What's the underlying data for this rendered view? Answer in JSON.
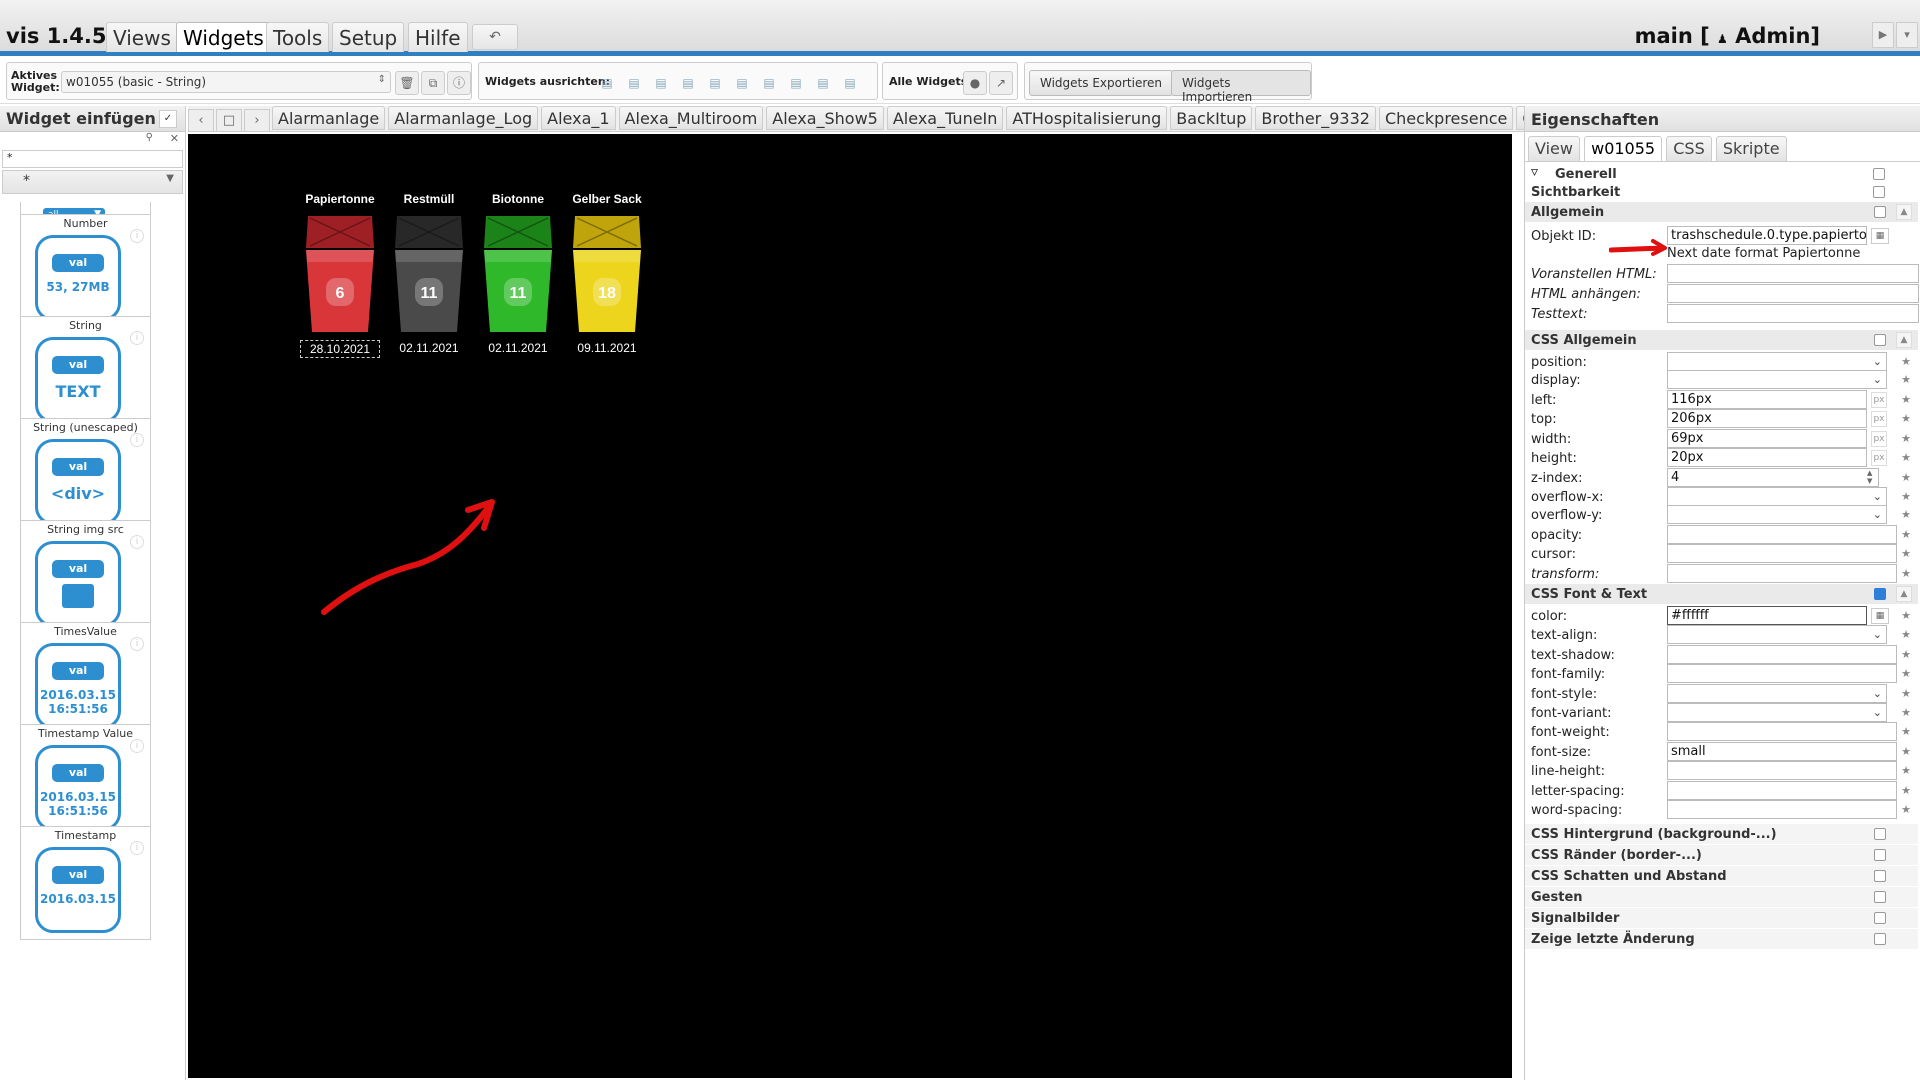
{
  "app": {
    "title": "vis 1.4.5",
    "project_label": "main [",
    "user_icon": "user-icon",
    "user": "Admin]"
  },
  "menu": {
    "tabs": [
      "Views",
      "Widgets",
      "Tools",
      "Setup",
      "Hilfe"
    ],
    "active": "Widgets",
    "undo": "↶"
  },
  "toolbar": {
    "active_widget_label": "Aktives Widget:",
    "active_widget_value": "w01055 (basic - String)",
    "align_label": "Widgets ausrichten:",
    "all_widgets_label": "Alle Widgets:",
    "export_label": "Widgets Exportieren",
    "import_label": "Widgets Importieren"
  },
  "left_panel": {
    "title": "Widget einfügen",
    "filter_value": "*",
    "set_value": "*",
    "top_select": "all",
    "cards": [
      {
        "title": "Number",
        "text": "53, 27MB"
      },
      {
        "title": "String",
        "text": "TEXT"
      },
      {
        "title": "String (unescaped)",
        "text": "<div>"
      },
      {
        "title": "String img src",
        "text": ""
      },
      {
        "title": "TimesValue",
        "text": "2016.03.15 16:51:56"
      },
      {
        "title": "Timestamp Value",
        "text": "2016.03.15 16:51:56"
      },
      {
        "title": "Timestamp",
        "text": "2016.03.15"
      }
    ],
    "val_badge": "val"
  },
  "view_tabs": [
    "Alarmanlage",
    "Alarmanlage_Log",
    "Alexa_1",
    "Alexa_Multiroom",
    "Alexa_Show5",
    "Alexa_TuneIn",
    "ATHospitalisierung",
    "BackItup",
    "Brother_9332",
    "Checkpresence",
    "Corona_At"
  ],
  "canvas": {
    "bins": [
      {
        "label": "Papiertonne",
        "days": "6",
        "date": "28.10.2021",
        "color": "#d9363a",
        "dark": "#a82226",
        "selected": true
      },
      {
        "label": "Restmüll",
        "days": "11",
        "date": "02.11.2021",
        "color": "#4a4a4a",
        "dark": "#2a2a2a",
        "selected": false
      },
      {
        "label": "Biotonne",
        "days": "11",
        "date": "02.11.2021",
        "color": "#2fb92a",
        "dark": "#1e8a1a",
        "selected": false
      },
      {
        "label": "Gelber Sack",
        "days": "18",
        "date": "09.11.2021",
        "color": "#ecd51c",
        "dark": "#c9ae0c",
        "selected": false
      }
    ]
  },
  "right_panel": {
    "title": "Eigenschaften",
    "tabs": [
      "View",
      "w01055",
      "CSS",
      "Skripte"
    ],
    "active_tab": "w01055",
    "generell": "Generell",
    "sichtbarkeit": "Sichtbarkeit",
    "allgemein": "Allgemein",
    "objekt_id_label": "Objekt ID:",
    "objekt_id_value": "trashschedule.0.type.papierto",
    "objekt_id_hint": "Next date format Papiertonne",
    "voranstellen": "Voranstellen HTML:",
    "anhaengen": "HTML anhängen:",
    "testtext": "Testtext:",
    "css_allgemein": "CSS Allgemein",
    "css_rows": [
      {
        "label": "position:",
        "value": ""
      },
      {
        "label": "display:",
        "value": ""
      },
      {
        "label": "left:",
        "value": "116px"
      },
      {
        "label": "top:",
        "value": "206px"
      },
      {
        "label": "width:",
        "value": "69px"
      },
      {
        "label": "height:",
        "value": "20px"
      },
      {
        "label": "z-index:",
        "value": "4"
      },
      {
        "label": "overflow-x:",
        "value": ""
      },
      {
        "label": "overflow-y:",
        "value": ""
      },
      {
        "label": "opacity:",
        "value": ""
      },
      {
        "label": "cursor:",
        "value": ""
      },
      {
        "label": "transform:",
        "value": ""
      }
    ],
    "px_unit": "px",
    "css_font_text": "CSS Font & Text",
    "font_rows": [
      {
        "label": "color:",
        "value": "#ffffff"
      },
      {
        "label": "text-align:",
        "value": ""
      },
      {
        "label": "text-shadow:",
        "value": ""
      },
      {
        "label": "font-family:",
        "value": ""
      },
      {
        "label": "font-style:",
        "value": ""
      },
      {
        "label": "font-variant:",
        "value": ""
      },
      {
        "label": "font-weight:",
        "value": ""
      },
      {
        "label": "font-size:",
        "value": "small"
      },
      {
        "label": "line-height:",
        "value": ""
      },
      {
        "label": "letter-spacing:",
        "value": ""
      },
      {
        "label": "word-spacing:",
        "value": ""
      }
    ],
    "sections_bottom": [
      "CSS Hintergrund (background-...)",
      "CSS Ränder (border-...)",
      "CSS Schatten und Abstand",
      "Gesten",
      "Signalbilder",
      "Zeige letzte Änderung"
    ]
  },
  "colors": {
    "accent": "#2f7fc1",
    "canvas_bg": "#000000",
    "annotation_red": "#e01010"
  }
}
